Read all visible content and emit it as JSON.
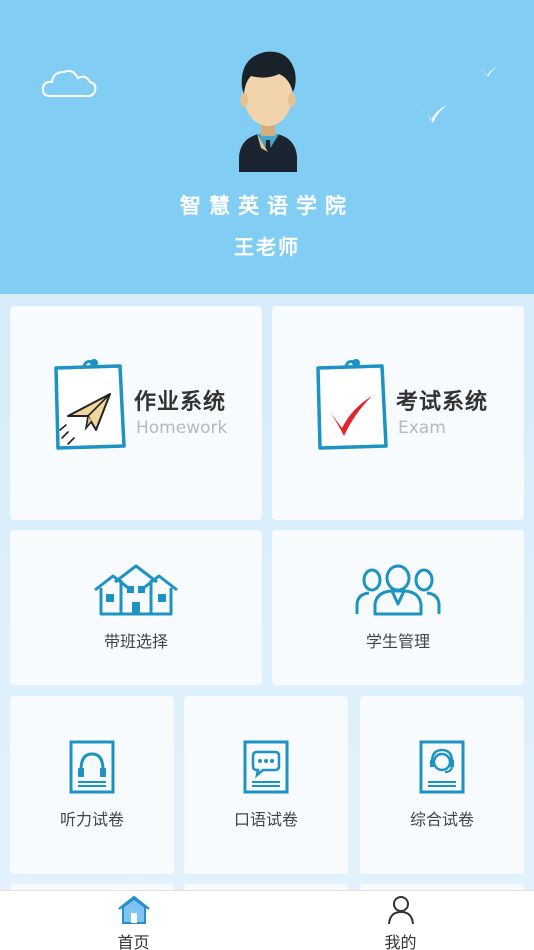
{
  "header": {
    "school_name": "智慧英语学院",
    "teacher_name": "王老师"
  },
  "cards": {
    "homework": {
      "title": "作业系统",
      "subtitle": "Homework"
    },
    "exam": {
      "title": "考试系统",
      "subtitle": "Exam"
    },
    "class_select": {
      "label": "带班选择"
    },
    "student_manage": {
      "label": "学生管理"
    },
    "listening": {
      "label": "听力试卷"
    },
    "speaking": {
      "label": "口语试卷"
    },
    "comprehensive": {
      "label": "综合试卷"
    }
  },
  "tabbar": {
    "home": "首页",
    "mine": "我的"
  },
  "colors": {
    "header_bg": "#82cdf4",
    "icon_blue": "#1d93c4",
    "check_red": "#e2252b"
  },
  "icons": {
    "homework": "paper-plane-icon",
    "exam": "checkmark-icon",
    "class_select": "houses-icon",
    "student_manage": "people-icon",
    "listening": "headphones-icon",
    "speaking": "speech-bubble-icon",
    "comprehensive": "headset-person-icon",
    "tab_home": "home-icon",
    "tab_mine": "user-icon"
  }
}
